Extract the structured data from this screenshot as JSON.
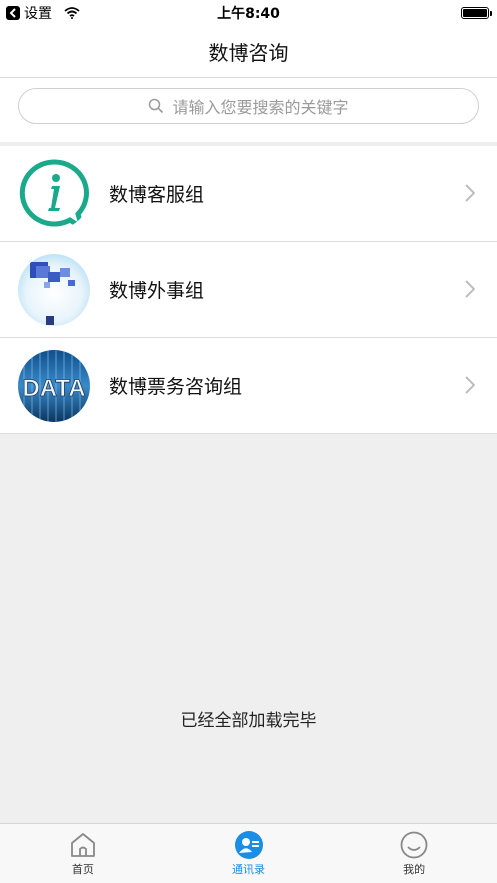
{
  "status_bar": {
    "back_app": "设置",
    "time": "上午8:40"
  },
  "nav": {
    "title": "数博咨询"
  },
  "search": {
    "placeholder": "请输入您要搜索的关键字",
    "icon": "search-icon"
  },
  "list": {
    "items": [
      {
        "label": "数博客服组",
        "avatar": "info-speech-bubble"
      },
      {
        "label": "数博外事组",
        "avatar": "blue-cubes-image"
      },
      {
        "label": "数博票务咨询组",
        "avatar": "data-text-image"
      }
    ]
  },
  "footer": {
    "loaded_text": "已经全部加载完毕"
  },
  "tabs": [
    {
      "label": "首页",
      "icon": "home-icon",
      "active": false
    },
    {
      "label": "通讯录",
      "icon": "contacts-icon",
      "active": true
    },
    {
      "label": "我的",
      "icon": "smiley-profile-icon",
      "active": false
    }
  ],
  "colors": {
    "accent": "#1a8de4",
    "info_green": "#1aa98a",
    "background": "#efefef"
  }
}
